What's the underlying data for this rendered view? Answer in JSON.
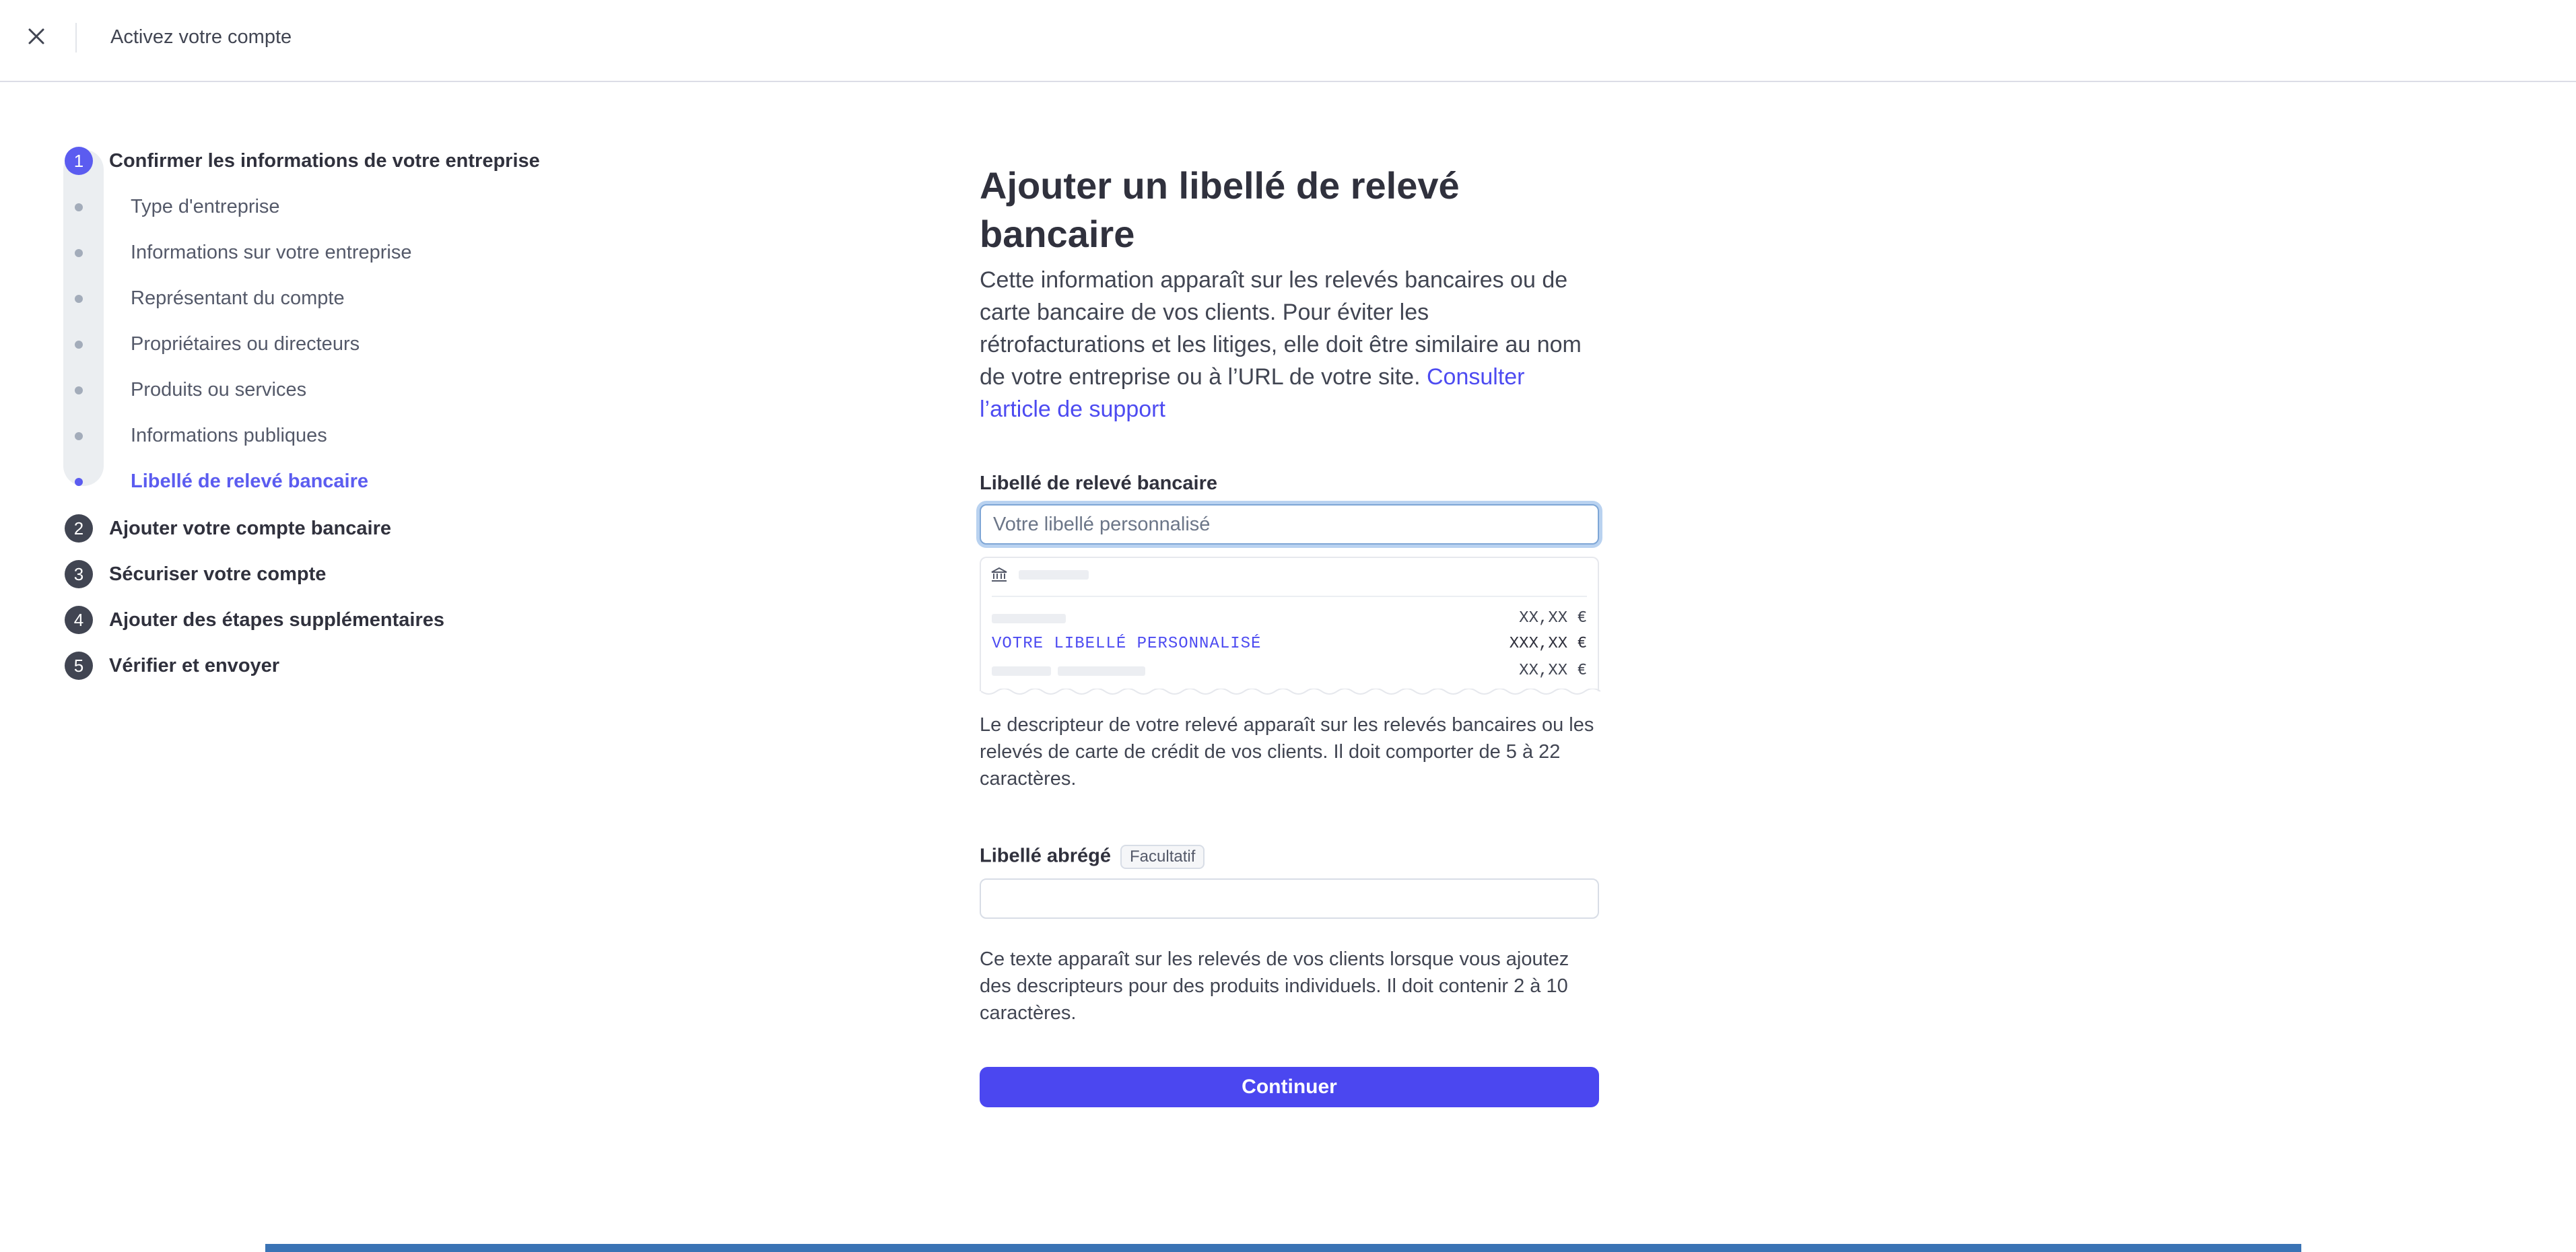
{
  "header": {
    "title": "Activez votre compte",
    "close_icon": "close-icon"
  },
  "stepper": {
    "steps": [
      {
        "number": "1",
        "label": "Confirmer les informations de votre entreprise",
        "active": true
      },
      {
        "number": "2",
        "label": "Ajouter votre compte bancaire",
        "active": false
      },
      {
        "number": "3",
        "label": "Sécuriser votre compte",
        "active": false
      },
      {
        "number": "4",
        "label": "Ajouter des étapes supplémentaires",
        "active": false
      },
      {
        "number": "5",
        "label": "Vérifier et envoyer",
        "active": false
      }
    ],
    "substeps": [
      {
        "label": "Type d'entreprise",
        "active": false
      },
      {
        "label": "Informations sur votre entreprise",
        "active": false
      },
      {
        "label": "Représentant du compte",
        "active": false
      },
      {
        "label": "Propriétaires ou directeurs",
        "active": false
      },
      {
        "label": "Produits ou services",
        "active": false
      },
      {
        "label": "Informations publiques",
        "active": false
      },
      {
        "label": "Libellé de relevé bancaire",
        "active": true
      }
    ]
  },
  "main": {
    "title": "Ajouter un libellé de relevé bancaire",
    "lead": "Cette information apparaît sur les relevés bancaires ou de carte bancaire de vos clients. Pour éviter les rétrofacturations et les litiges, elle doit être similaire au nom de votre entreprise ou à l’URL de votre site.",
    "support_link": "Consulter l’article de support",
    "statement_field": {
      "label": "Libellé de relevé bancaire",
      "placeholder": "Votre libellé personnalisé",
      "value": ""
    },
    "preview": {
      "bank_icon": "bank-icon",
      "custom_label": "VOTRE LIBELLÉ PERSONNALISÉ",
      "amount_1": "XX,XX €",
      "amount_2": "XXX,XX €",
      "amount_3": "XX,XX €"
    },
    "statement_help": "Le descripteur de votre relevé apparaît sur les relevés bancaires ou les relevés de carte de crédit de vos clients. Il doit comporter de 5 à 22 caractères.",
    "short_field": {
      "label": "Libellé abrégé",
      "badge": "Facultatif",
      "value": ""
    },
    "short_help": "Ce texte apparaît sur les relevés de vos clients lorsque vous ajoutez des descripteurs pour des produits individuels. Il doit contenir 2 à 10 caractères.",
    "continue_label": "Continuer"
  },
  "colors": {
    "accent": "#4b47f0",
    "active_step": "#5b5cf0",
    "link": "#4d4bf1",
    "bottom_bar": "#3a73b5"
  }
}
